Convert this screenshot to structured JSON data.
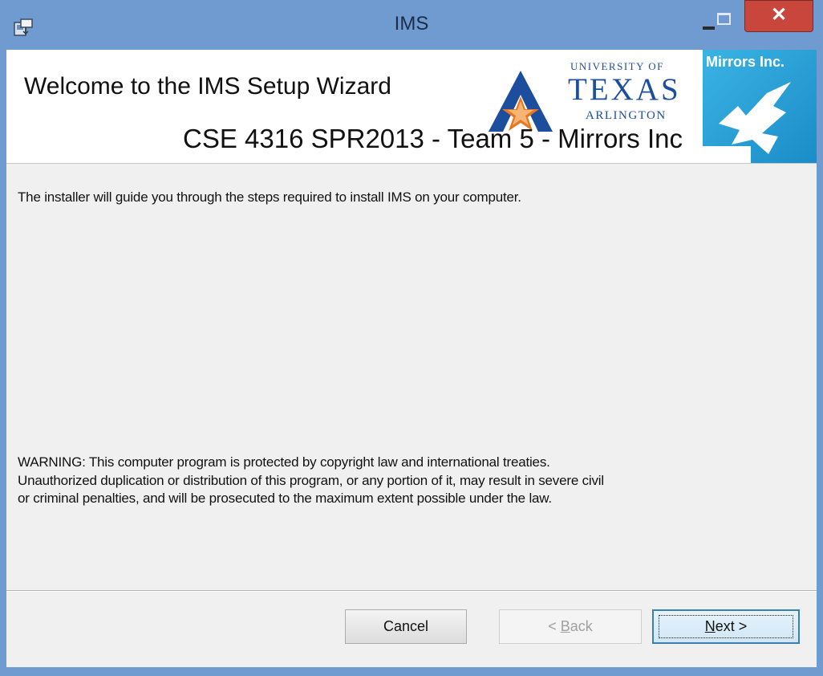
{
  "window": {
    "title": "IMS",
    "close_glyph": "✕",
    "icons": [
      "installer-app-icon",
      "minimize-icon",
      "maximize-icon",
      "close-icon"
    ]
  },
  "header": {
    "title": "Welcome to the IMS Setup Wizard",
    "subtitle": "CSE 4316 SPR2013 - Team 5 - Mirrors Inc",
    "uta_logo": {
      "line1": "UNIVERSITY OF",
      "line2": "TEXAS",
      "line3": "ARLINGTON"
    },
    "mirrors_logo": {
      "text": "Mirrors Inc."
    }
  },
  "content": {
    "intro": "The installer will guide you through the steps required to install IMS on your computer.",
    "warning": "WARNING: This computer program is protected by copyright law and international treaties.\nUnauthorized duplication or distribution of this program, or any portion of it, may result in severe civil\nor criminal penalties, and will be prosecuted to the maximum extent possible under the law."
  },
  "buttons": {
    "cancel": "Cancel",
    "back_prefix": "< ",
    "back_mnemonic": "B",
    "back_rest": "ack",
    "next_mnemonic": "N",
    "next_rest": "ext >"
  },
  "colors": {
    "window_frame": "#6f9bd0",
    "close_button": "#c9463d",
    "uta_blue": "#1d4e9e",
    "uta_orange": "#e87722",
    "mirrors_blue": "#2aa0d6",
    "dialog_background": "#f0f0f0"
  }
}
